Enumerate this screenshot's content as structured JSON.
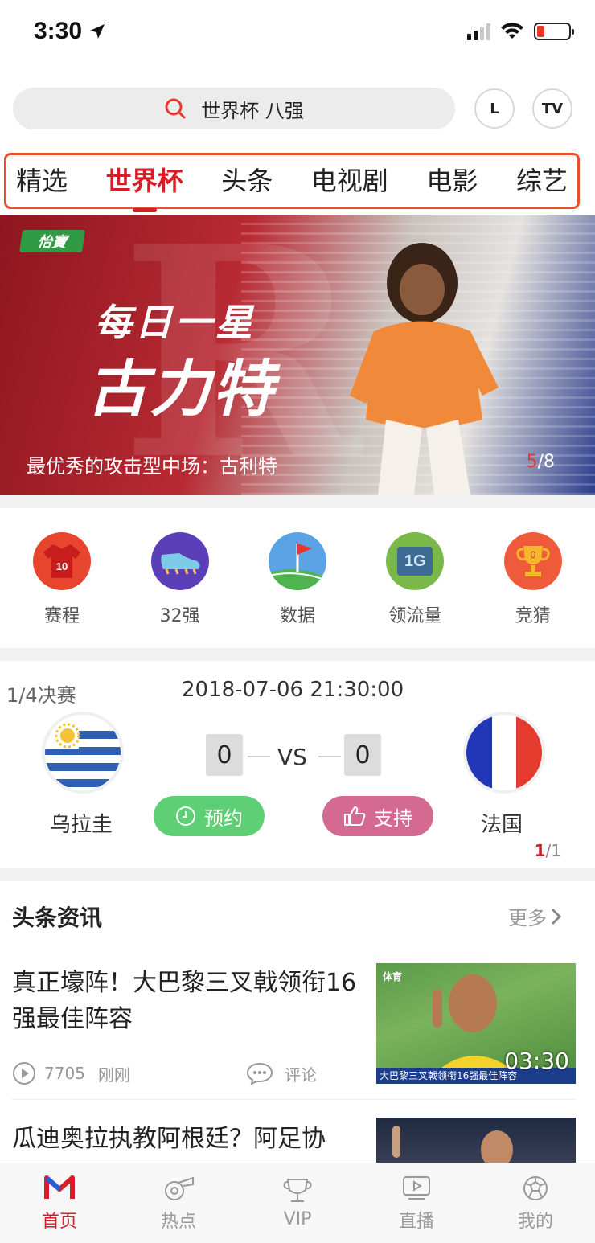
{
  "status": {
    "time": "3:30"
  },
  "search": {
    "query": "世界杯 八强",
    "btn_l": "L",
    "btn_tv": "TV"
  },
  "tabs": [
    {
      "label": "精选",
      "active": false
    },
    {
      "label": "世界杯",
      "active": true
    },
    {
      "label": "头条",
      "active": false
    },
    {
      "label": "电视剧",
      "active": false
    },
    {
      "label": "电影",
      "active": false
    },
    {
      "label": "综艺",
      "active": false
    }
  ],
  "banner": {
    "brand": "怡寶",
    "line1": "每日一星",
    "line2": "古力特",
    "caption": "最优秀的攻击型中场：古利特",
    "page_current": "5",
    "page_total": "/8"
  },
  "shortcuts": [
    {
      "label": "赛程",
      "icon": "jersey-icon",
      "badge": "10"
    },
    {
      "label": "32强",
      "icon": "football-boot-icon"
    },
    {
      "label": "数据",
      "icon": "corner-flag-icon"
    },
    {
      "label": "领流量",
      "icon": "data-1g-icon",
      "badge": "1G"
    },
    {
      "label": "竞猜",
      "icon": "trophy-icon",
      "badge": "0"
    }
  ],
  "match": {
    "stage": "1/4决赛",
    "datetime": "2018-07-06 21:30:00",
    "home": {
      "name": "乌拉圭",
      "score": "0"
    },
    "away": {
      "name": "法国",
      "score": "0"
    },
    "vs": "VS",
    "reserve_label": "预约",
    "support_label": "支持",
    "page_current": "1",
    "page_total": "/1"
  },
  "news": {
    "section_title": "头条资讯",
    "more_label": "更多",
    "articles": [
      {
        "title": "真正壕阵！大巴黎三叉戟领衔16强最佳阵容",
        "plays": "7705",
        "time": "刚刚",
        "comment_label": "评论",
        "duration": "03:30",
        "thumb_logo": "体育",
        "thumb_strip": "大巴黎三叉戟领衔16强最佳阵容"
      },
      {
        "title": "瓜迪奥拉执教阿根廷？阿足协"
      }
    ]
  },
  "bottom_nav": [
    {
      "label": "首页",
      "icon": "home-logo-icon",
      "active": true
    },
    {
      "label": "热点",
      "icon": "whistle-icon",
      "active": false
    },
    {
      "label": "VIP",
      "icon": "vip-cup-icon",
      "active": false
    },
    {
      "label": "直播",
      "icon": "live-play-icon",
      "active": false
    },
    {
      "label": "我的",
      "icon": "ball-profile-icon",
      "active": false
    }
  ],
  "colors": {
    "accent": "#d71d28",
    "tab_outline": "#e8502c",
    "reserve": "#5fcf76",
    "support": "#d46a8f"
  }
}
